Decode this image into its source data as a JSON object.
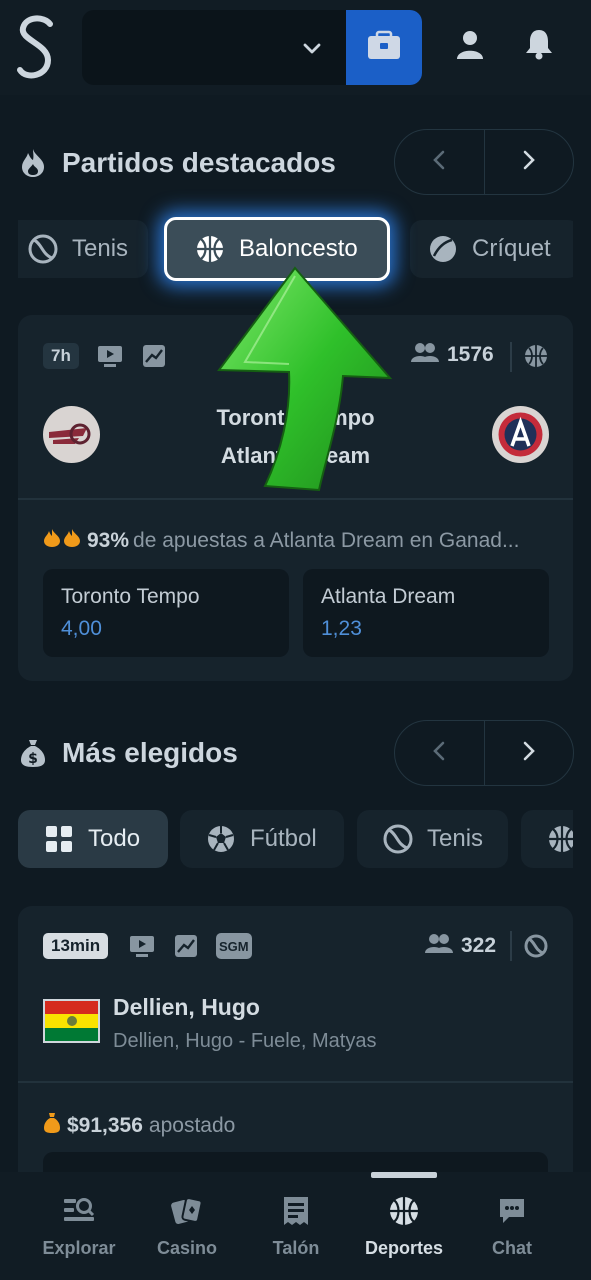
{
  "header": {
    "logo_letter": "S",
    "balance_value": "",
    "icons": [
      "chevron-down-icon",
      "wallet-icon",
      "user-icon",
      "bell-icon"
    ]
  },
  "featured": {
    "title": "Partidos destacados",
    "title_icon": "fire-icon",
    "chips": [
      {
        "label": "Tenis",
        "icon": "tennis-icon"
      },
      {
        "label": "Baloncesto",
        "icon": "basketball-icon"
      },
      {
        "label": "Críquet",
        "icon": "cricket-icon"
      }
    ],
    "match": {
      "time_badge": "7h",
      "users_count": "1576",
      "team1": "Toronto Tempo",
      "team2": "Atlanta Dream",
      "hot_prefix": "93%",
      "hot_text": "de apuestas a Atlanta Dream en Ganad...",
      "odds": [
        {
          "name": "Toronto Tempo",
          "value": "4,00"
        },
        {
          "name": "Atlanta Dream",
          "value": "1,23"
        }
      ]
    }
  },
  "most_picked": {
    "title": "Más elegidos",
    "title_icon": "money-bag-icon",
    "chips": [
      {
        "label": "Todo",
        "icon": "grid-icon"
      },
      {
        "label": "Fútbol",
        "icon": "soccer-icon"
      },
      {
        "label": "Tenis",
        "icon": "tennis-icon"
      }
    ],
    "match": {
      "time_badge": "13min",
      "sgm_badge": "SGM",
      "users_count": "322",
      "player": "Dellien, Hugo",
      "subtitle": "Dellien, Hugo - Fuele, Matyas",
      "wagered_amount": "$91,356",
      "wagered_label": "apostado"
    }
  },
  "nav": {
    "items": [
      {
        "label": "Explorar",
        "icon": "explore-icon"
      },
      {
        "label": "Casino",
        "icon": "cards-icon"
      },
      {
        "label": "Talón",
        "icon": "betslip-icon"
      },
      {
        "label": "Deportes",
        "icon": "basketball-icon"
      },
      {
        "label": "Chat",
        "icon": "chat-icon"
      }
    ],
    "active": "Deportes"
  },
  "colors": {
    "background": "#0f1a22",
    "card": "#16232c",
    "accent_blue": "#1b5fc7",
    "odds_blue": "#4f8fd8",
    "arrow_green": "#2fc02a"
  }
}
